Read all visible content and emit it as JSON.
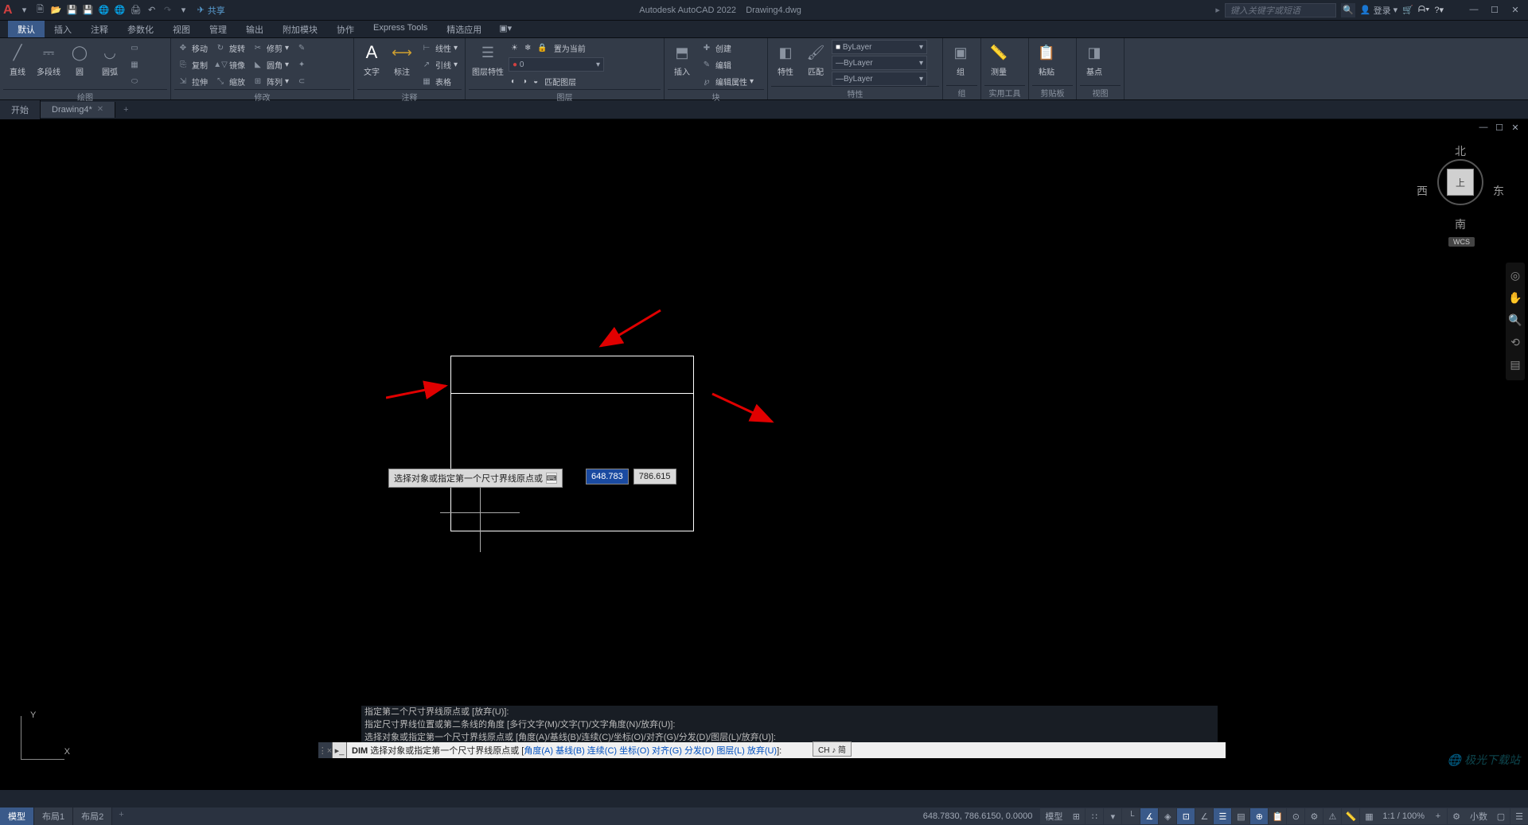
{
  "titlebar": {
    "app_title": "Autodesk AutoCAD 2022",
    "doc_title": "Drawing4.dwg",
    "share": "共享",
    "search_placeholder": "键入关键字或短语",
    "login": "登录"
  },
  "ribbon_tabs": [
    "默认",
    "插入",
    "注释",
    "参数化",
    "视图",
    "管理",
    "输出",
    "附加模块",
    "协作",
    "Express Tools",
    "精选应用"
  ],
  "ribbon": {
    "draw": {
      "line": "直线",
      "polyline": "多段线",
      "circle": "圆",
      "arc": "圆弧",
      "label": "绘图"
    },
    "modify": {
      "move": "移动",
      "rotate": "旋转",
      "trim": "修剪",
      "copy": "复制",
      "mirror": "镜像",
      "fillet": "圆角",
      "stretch": "拉伸",
      "scale": "缩放",
      "array": "阵列",
      "label": "修改"
    },
    "annotate": {
      "text": "文字",
      "dim": "标注",
      "linear": "线性",
      "leader": "引线",
      "table": "表格",
      "label": "注释"
    },
    "layers": {
      "props": "图层特性",
      "setcur": "置为当前",
      "match": "匹配图层",
      "label": "图层"
    },
    "block": {
      "insert": "插入",
      "create": "创建",
      "edit": "编辑",
      "editattr": "编辑属性",
      "label": "块"
    },
    "props": {
      "props": "特性",
      "match": "匹配",
      "bylayer": "ByLayer",
      "label": "特性"
    },
    "group": {
      "g": "组",
      "label": "组"
    },
    "utils": {
      "measure": "测量",
      "label": "实用工具"
    },
    "clip": {
      "paste": "粘贴",
      "label": "剪贴板"
    },
    "view": {
      "base": "基点",
      "label": "视图"
    }
  },
  "filetabs": {
    "start": "开始",
    "drawing": "Drawing4*"
  },
  "viewcube": {
    "n": "北",
    "s": "南",
    "e": "东",
    "w": "西",
    "top": "上",
    "wcs": "WCS"
  },
  "dyn": {
    "tip": "选择对象或指定第一个尺寸界线原点或",
    "x": "648.783",
    "y": "786.615"
  },
  "ucs": {
    "x": "X",
    "y": "Y"
  },
  "cmdhist": [
    "指定第二个尺寸界线原点或 [放弃(U)]:",
    "指定尺寸界线位置或第二条线的角度 [多行文字(M)/文字(T)/文字角度(N)/放弃(U)]:",
    "选择对象或指定第一个尺寸界线原点或 [角度(A)/基线(B)/连续(C)/坐标(O)/对齐(G)/分发(D)/图层(L)/放弃(U)]:"
  ],
  "cmdline": {
    "cmd": "DIM",
    "text": "选择对象或指定第一个尺寸界线原点或 [",
    "opts": "角度(A) 基线(B) 连续(C) 坐标(O) 对齐(G) 分发(D) 图层(L) 放弃(U)",
    "suffix": "]:",
    "ime": "CH ♪ 简"
  },
  "status": {
    "model": "模型",
    "layout1": "布局1",
    "layout2": "布局2",
    "coords": "648.7830, 786.6150, 0.0000",
    "mode": "模型",
    "scale": "1:1 / 100%",
    "dec": "小数"
  },
  "watermark": "极光下载站"
}
